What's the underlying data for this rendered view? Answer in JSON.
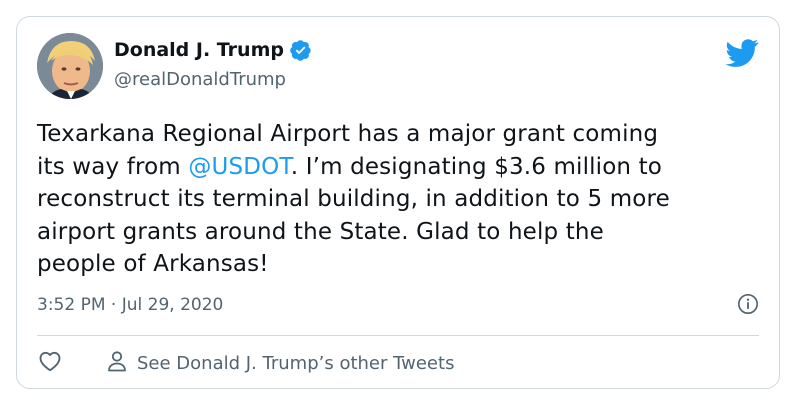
{
  "author": {
    "name": "Donald J. Trump",
    "handle": "@realDonaldTrump"
  },
  "tweet": {
    "text_line1_part1": "Texarkana Regional Airport has a major grant coming",
    "text_line2_part1": "its way from ",
    "mention": "@USDOT",
    "text_line2_part2": ". I’m designating $3.6 million to",
    "text_line3": "reconstruct its terminal building, in addition to 5 more",
    "text_line4": "airport grants around the State. Glad to help the",
    "text_line5": "people of Arkansas!"
  },
  "meta": {
    "timestamp": "3:52 PM · Jul 29, 2020"
  },
  "actions": {
    "other_tweets_label": "See Donald J. Trump’s other Tweets"
  },
  "colors": {
    "accent": "#1d9bf0",
    "secondary_text": "#536471",
    "border": "#cfd9de"
  },
  "icons": {
    "verified": "verified-badge-icon",
    "brand": "twitter-bird-icon",
    "info": "info-icon",
    "like": "heart-icon",
    "profile": "person-icon"
  }
}
